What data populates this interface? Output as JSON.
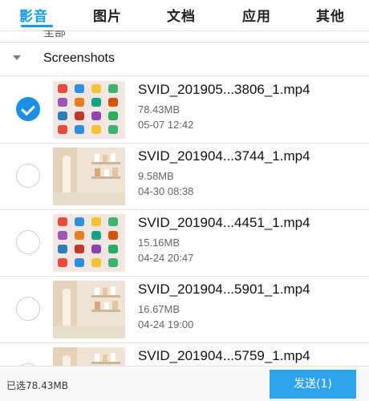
{
  "tabs": [
    {
      "label": "影音",
      "active": true
    },
    {
      "label": "图片",
      "active": false
    },
    {
      "label": "文档",
      "active": false
    },
    {
      "label": "应用",
      "active": false
    },
    {
      "label": "其他",
      "active": false
    }
  ],
  "colors": {
    "accent": "#1a9ae6",
    "check": "#1b8fe6",
    "button": "#2fa3ee"
  },
  "prev_row_text": "全部",
  "group": {
    "title": "Screenshots",
    "icon": "caret-down-icon"
  },
  "files": [
    {
      "name": "SVID_201905...3806_1.mp4",
      "size": "78.43MB",
      "date": "05-07 12:42",
      "checked": true,
      "thumb": "home-screen"
    },
    {
      "name": "SVID_201904...3744_1.mp4",
      "size": "9.58MB",
      "date": "04-30 08:38",
      "checked": false,
      "thumb": "bathroom"
    },
    {
      "name": "SVID_201904...4451_1.mp4",
      "size": "15.16MB",
      "date": "04-24 20:47",
      "checked": false,
      "thumb": "home-screen"
    },
    {
      "name": "SVID_201904...5901_1.mp4",
      "size": "16.67MB",
      "date": "04-24 19:00",
      "checked": false,
      "thumb": "bathroom"
    },
    {
      "name": "SVID_201904...5759_1.mp4",
      "size": "",
      "date": "",
      "checked": false,
      "thumb": "bathroom"
    }
  ],
  "bottom": {
    "selected_text": "已选78.43MB",
    "send_label": "发送(1)"
  }
}
